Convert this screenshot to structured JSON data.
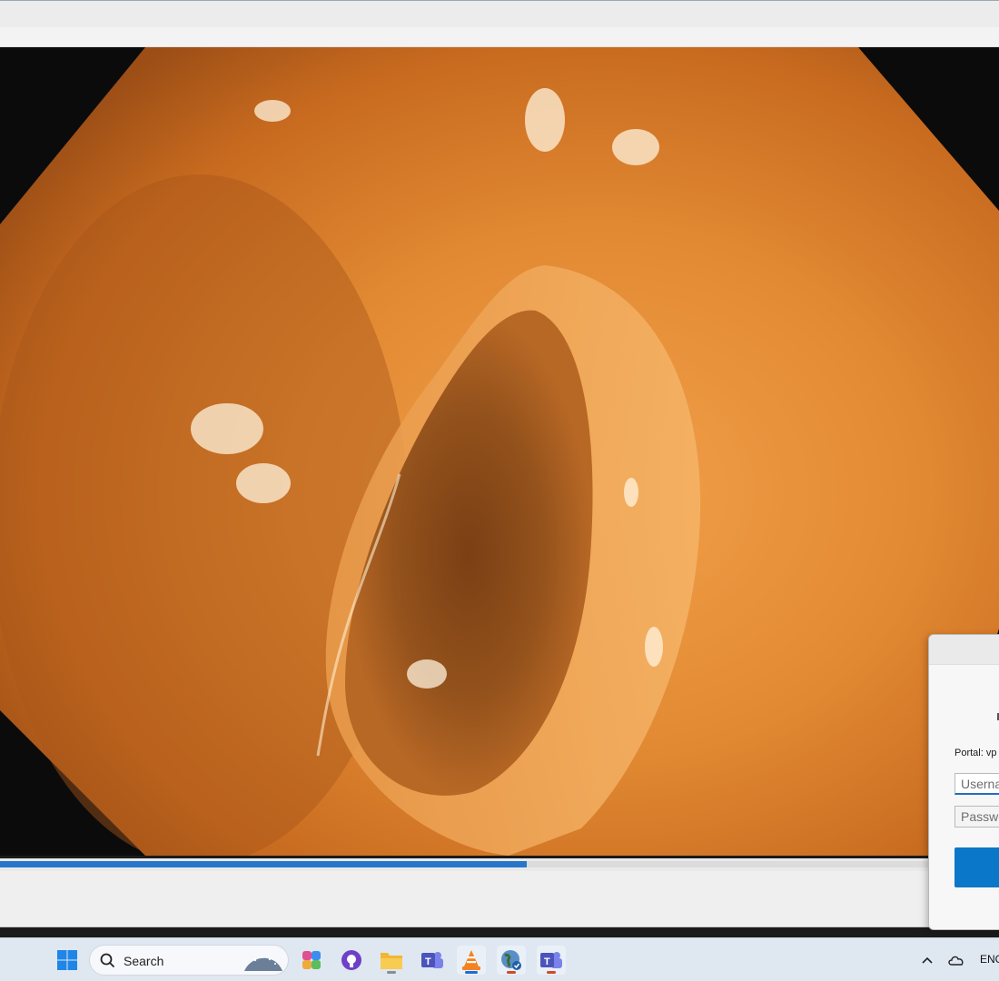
{
  "vpn_dialog": {
    "portal_label": "Portal: vp",
    "username_placeholder": "Userna",
    "password_placeholder": "Passwo"
  },
  "player": {
    "progress": 0.527
  },
  "taskbar": {
    "search_label": "Search",
    "language": "ENG",
    "icons": [
      "windows-start-icon",
      "search-icon",
      "copilot-icon",
      "github-icon",
      "file-explorer-icon",
      "teams-icon",
      "vlc-icon",
      "vpn-globe-icon",
      "teams-work-icon",
      "chevron-up-icon",
      "onedrive-cloud-icon"
    ]
  },
  "colors": {
    "accent": "#0a77c9",
    "seek_fill": "#2677c9",
    "taskbar": "#dfe7f1"
  }
}
